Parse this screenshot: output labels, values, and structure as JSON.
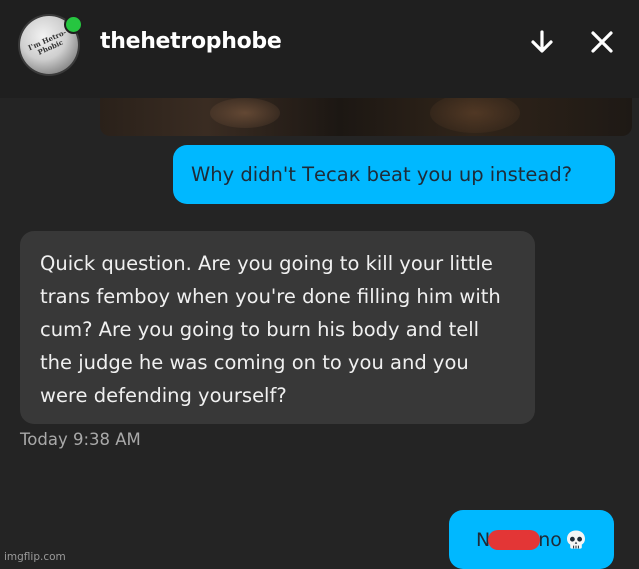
{
  "header": {
    "username": "thehetrophobe",
    "avatar_text": "I'm Hetro-Phobic",
    "online_color": "#26c640",
    "download_icon": "arrow-down-icon",
    "close_icon": "close-icon"
  },
  "messages": {
    "outgoing_1": "Why didn't Тесак beat you up instead?",
    "incoming_1": "Quick question. Are you going to kill your little trans femboy when you're done filling him with cum? Are you going to burn his body and tell the judge he was coming on to you and you were defending yourself?",
    "timestamp": "Today 9:38 AM",
    "outgoing_2_start": "N",
    "outgoing_2_end": "no",
    "outgoing_2_emoji": "skull-icon"
  },
  "colors": {
    "outgoing_bubble": "#00b8ff",
    "incoming_bubble": "#383838",
    "background": "#242424",
    "redaction": "#e33636"
  },
  "watermark": "imgflip.com"
}
